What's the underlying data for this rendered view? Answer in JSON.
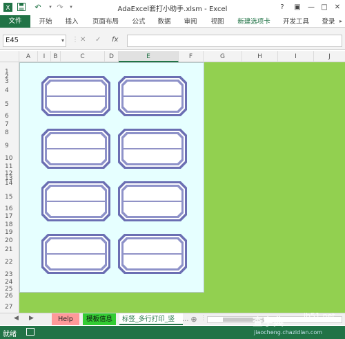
{
  "window": {
    "title": "AdaExcel套打小助手.xlsm - Excel",
    "help_label": "?",
    "minimize_label": "—",
    "restore_label": "□",
    "close_label": "✕"
  },
  "quick_access": [
    {
      "icon": "save-icon",
      "glyph": "💾"
    },
    {
      "icon": "undo-icon",
      "glyph": "↶"
    },
    {
      "icon": "redo-icon",
      "glyph": "↷"
    },
    {
      "icon": "customize-icon",
      "glyph": "▾"
    }
  ],
  "ribbon": {
    "file": "文件",
    "tabs": [
      "开始",
      "插入",
      "页面布局",
      "公式",
      "数据",
      "审阅",
      "视图",
      "新建选项卡",
      "开发工具",
      "登录"
    ]
  },
  "formula_bar": {
    "name_box": "E45",
    "cancel_glyph": "✕",
    "enter_glyph": "✓",
    "fx_glyph": "fx",
    "value": ""
  },
  "columns": [
    "A",
    "I",
    "B",
    "C",
    "D",
    "E",
    "F",
    "G",
    "H",
    "I",
    "J"
  ],
  "selected_column": "E",
  "rows": [
    "1",
    "2",
    "3",
    "4",
    "5",
    "6",
    "7",
    "8",
    "9",
    "10",
    "11",
    "12",
    "13",
    "14",
    "15",
    "16",
    "17",
    "18",
    "19",
    "20",
    "21",
    "22",
    "23",
    "24",
    "25",
    "26",
    "27"
  ],
  "labels": {
    "count": 8,
    "frame_color": "#6b6fb3",
    "fill_color": "#ffffff"
  },
  "sheet_tabs": [
    {
      "label": "Help",
      "color": "#ff9999"
    },
    {
      "label": "模板信息",
      "color": "#33cc33"
    },
    {
      "label": "标签_多行打印_竖",
      "color": "#ffffff"
    }
  ],
  "sheet_nav": {
    "prev": "◀",
    "next": "▶",
    "add": "⊕"
  },
  "status": {
    "text": "就绪"
  },
  "colors": {
    "accent": "#217346",
    "sheet_background": "#92d050",
    "page_background": "#e6ffff"
  },
  "watermark": {
    "line1": "查字典",
    "line2": "jb51.net",
    "line3": "jiaocheng.chazidian.com"
  }
}
